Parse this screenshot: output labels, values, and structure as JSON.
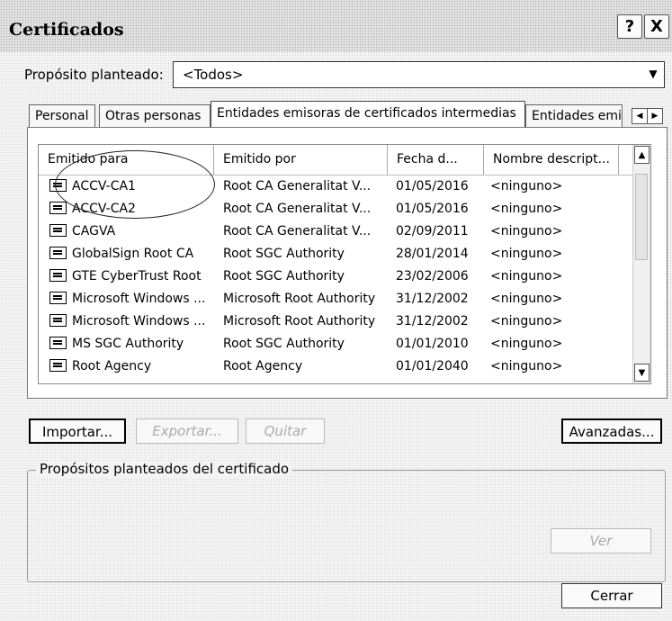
{
  "window": {
    "title": "Certificados"
  },
  "titlebar_buttons": {
    "help": "?",
    "close": "X"
  },
  "purpose": {
    "label": "Propósito planteado:",
    "value": "<Todos>"
  },
  "tabs": [
    {
      "label": "Personal",
      "active": false
    },
    {
      "label": "Otras personas",
      "active": false
    },
    {
      "label": "Entidades emisoras de certificados intermedias",
      "active": true
    },
    {
      "label": "Entidades emi",
      "active": false
    }
  ],
  "list": {
    "columns": [
      "Emitido para",
      "Emitido por",
      "Fecha d...",
      "Nombre descript..."
    ],
    "rows": [
      {
        "issued_to": "ACCV-CA1",
        "issued_by": "Root CA Generalitat V...",
        "date": "01/05/2016",
        "name": "<ninguno>"
      },
      {
        "issued_to": "ACCV-CA2",
        "issued_by": "Root CA Generalitat V...",
        "date": "01/05/2016",
        "name": "<ninguno>"
      },
      {
        "issued_to": "CAGVA",
        "issued_by": "Root CA Generalitat V...",
        "date": "02/09/2011",
        "name": "<ninguno>"
      },
      {
        "issued_to": "GlobalSign Root CA",
        "issued_by": "Root SGC Authority",
        "date": "28/01/2014",
        "name": "<ninguno>"
      },
      {
        "issued_to": "GTE CyberTrust Root",
        "issued_by": "Root SGC Authority",
        "date": "23/02/2006",
        "name": "<ninguno>"
      },
      {
        "issued_to": "Microsoft Windows ...",
        "issued_by": "Microsoft Root Authority",
        "date": "31/12/2002",
        "name": "<ninguno>"
      },
      {
        "issued_to": "Microsoft Windows ...",
        "issued_by": "Microsoft Root Authority",
        "date": "31/12/2002",
        "name": "<ninguno>"
      },
      {
        "issued_to": "MS SGC Authority",
        "issued_by": "Root SGC Authority",
        "date": "01/01/2010",
        "name": "<ninguno>"
      },
      {
        "issued_to": "Root Agency",
        "issued_by": "Root Agency",
        "date": "01/01/2040",
        "name": "<ninguno>"
      }
    ]
  },
  "buttons": {
    "import": "Importar...",
    "export": "Exportar...",
    "remove": "Quitar",
    "advanced": "Avanzadas...",
    "view": "Ver",
    "close": "Cerrar"
  },
  "purposes_group": {
    "label": "Propósitos planteados del certificado"
  }
}
